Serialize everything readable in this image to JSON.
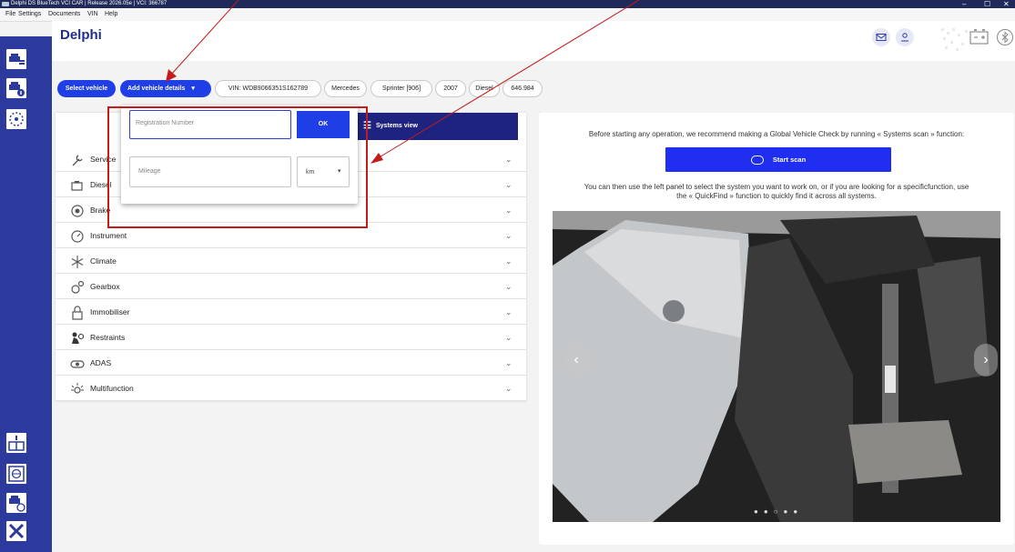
{
  "window": {
    "title": "Delphi DS BlueTech VCI CAR | Release 2026.05e | VCI: 366787",
    "minimize": "–",
    "restore": "☐",
    "close": "✕"
  },
  "menu": [
    "File",
    "Settings",
    "Documents",
    "VIN",
    "Help"
  ],
  "app": {
    "logo": "Delphi"
  },
  "vehicle_bar": {
    "select_vehicle": "Select vehicle",
    "add_details": "Add vehicle details",
    "vin": "VIN: WDB9066351S162789",
    "make": "Mercedes",
    "model": "Sprinter [906]",
    "year": "2007",
    "fuel": "Diesel",
    "engine": "646.984"
  },
  "popover": {
    "registration_placeholder": "Registration Number",
    "ok_label": "OK",
    "mileage_placeholder": "Mileage",
    "unit_value": "km"
  },
  "systems_view_label": "Systems view",
  "systems": [
    {
      "label": "Service",
      "icon": "wrench-icon"
    },
    {
      "label": "Diesel",
      "icon": "engine-icon"
    },
    {
      "label": "Brake",
      "icon": "brake-icon"
    },
    {
      "label": "Instrument",
      "icon": "gauge-icon"
    },
    {
      "label": "Climate",
      "icon": "snowflake-icon"
    },
    {
      "label": "Gearbox",
      "icon": "gears-icon"
    },
    {
      "label": "Immobiliser",
      "icon": "lock-icon"
    },
    {
      "label": "Restraints",
      "icon": "airbag-icon"
    },
    {
      "label": "ADAS",
      "icon": "camera-icon"
    },
    {
      "label": "Multifunction",
      "icon": "light-icon"
    }
  ],
  "right_panel": {
    "intro": "Before starting any operation, we recommend making a Global Vehicle Check by running « Systems scan » function:",
    "scan_label": "Start scan",
    "hint_line1": "You can then use the left panel to select the system you want to work on, or if you are looking for a specificfunction, use",
    "hint_line2": "the « QuickFind » function to quickly find it across all systems."
  },
  "colors": {
    "brand_blue": "#1f3ee6",
    "sidebar_blue": "#2b3a9c",
    "annotation_red": "#c41b1b"
  }
}
